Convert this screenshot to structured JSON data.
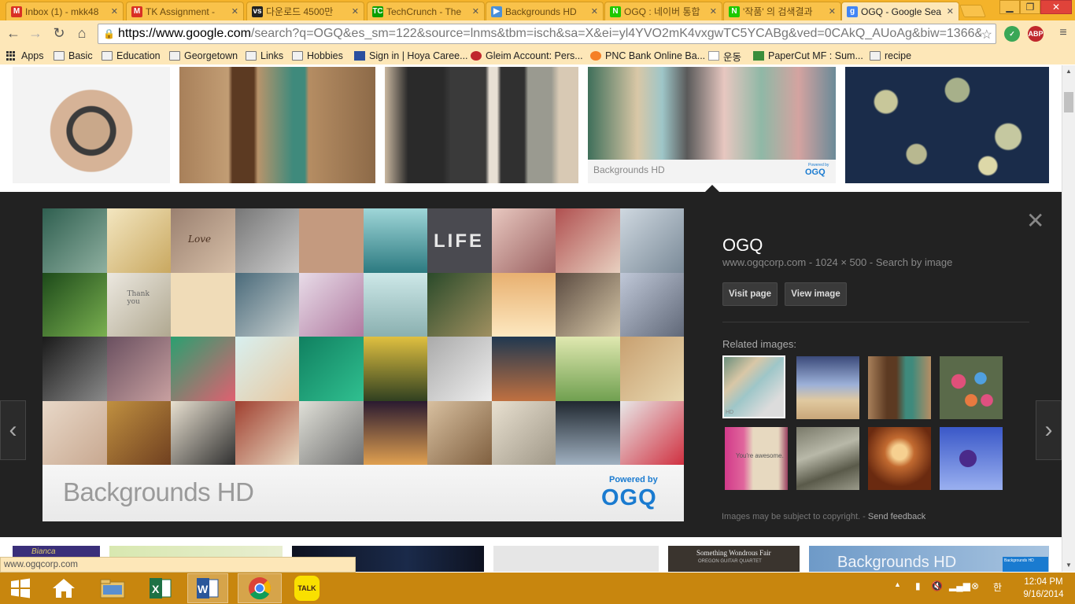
{
  "tabs": [
    {
      "title": "Inbox (1) - mkk48",
      "favicon": "gmail-icon",
      "color": "#d93025",
      "glyph": "M"
    },
    {
      "title": "TK Assignment - ",
      "favicon": "gmail-icon",
      "color": "#d93025",
      "glyph": "M"
    },
    {
      "title": "다운로드 4500만",
      "favicon": "vs-icon",
      "color": "#222222",
      "glyph": "vs"
    },
    {
      "title": "TechCrunch - The",
      "favicon": "techcrunch-icon",
      "color": "#0a9e01",
      "glyph": "TC"
    },
    {
      "title": "Backgrounds HD",
      "favicon": "play-store-icon",
      "color": "#4a90d9",
      "glyph": "▶"
    },
    {
      "title": "OGQ : 네이버 통합",
      "favicon": "naver-icon",
      "color": "#1ec800",
      "glyph": "N"
    },
    {
      "title": "'작품' 의 검색결과",
      "favicon": "naver-icon",
      "color": "#1ec800",
      "glyph": "N"
    },
    {
      "title": "OGQ - Google Sea",
      "favicon": "google-icon",
      "color": "#4285f4",
      "glyph": "g"
    }
  ],
  "url": {
    "host": "https://www.google.com",
    "rest": "/search?q=OGQ&es_sm=122&source=lnms&tbm=isch&sa=X&ei=yl4YVO2mK4vxgwTC5YCABg&ved=0CAkQ_AUoAg&biw=1366&"
  },
  "bookmarks": [
    "Apps",
    "Basic",
    "Education",
    "Georgetown",
    "Links",
    "Hobbies",
    "Sign in | Hoya Caree...",
    "Gleim Account: Pers...",
    "PNC Bank Online Ba...",
    "운동",
    "PaperCut MF : Sum...",
    "recipe"
  ],
  "top_results": {
    "backgrounds_caption": "Backgrounds HD",
    "powered_by": "Powered by",
    "logo": "OGQ"
  },
  "detail": {
    "title": "OGQ",
    "domain": "www.ogqcorp.com",
    "dimensions": "1024 × 500",
    "search_by_image": "Search by image",
    "visit_page": "Visit page",
    "view_image": "View image",
    "related_heading": "Related images:",
    "related_hd": "HD",
    "related_note": "You're awesome.",
    "copyright": "Images may be subject to copyright.",
    "send_feedback": "Send feedback",
    "main_caption": "Backgrounds HD",
    "main_powered": "Powered by",
    "main_logo": "OGQ",
    "life_text": "LIFE",
    "love_text": "Love",
    "thank_text": "Thank you"
  },
  "bottom_row": {
    "fair_title": "Something Wondrous Fair",
    "fair_sub": "OREGON GUITAR QUARTET",
    "bghd": "Backgrounds HD",
    "badge": "Backgrounds HD",
    "bianca": "Bianca"
  },
  "status_url": "www.ogqcorp.com",
  "taskbar": {
    "kakao": "TALK",
    "time": "12:04 PM",
    "date": "9/16/2014",
    "ime": "한"
  },
  "colors": {
    "tabstrip": "#f4b32a",
    "toolbar": "#fde7b8",
    "detail_bg": "#222222",
    "taskbar": "#c8860e"
  }
}
